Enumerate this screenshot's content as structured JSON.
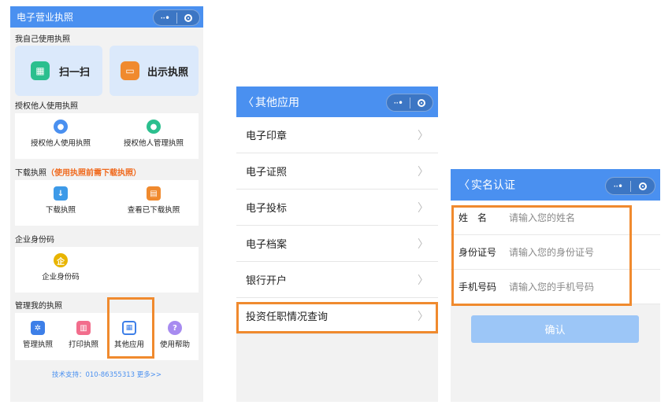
{
  "screen1": {
    "nav_title": "电子营业执照",
    "menu_dots": "··•",
    "section_own": "我自己使用执照",
    "scan_label": "扫一扫",
    "show_license_label": "出示执照",
    "section_authorize": "授权他人使用执照",
    "authorize_use_label": "授权他人使用执照",
    "authorize_manage_label": "授权他人管理执照",
    "section_download": "下载执照",
    "section_download_note": "（使用执照前需下载执照）",
    "download_label": "下载执照",
    "view_downloaded_label": "查看已下载执照",
    "section_enterprise_id": "企业身份码",
    "enterprise_id_label": "企业身份码",
    "enterprise_icon_char": "企",
    "section_manage": "管理我的执照",
    "manage_label": "管理执照",
    "print_label": "打印执照",
    "other_apps_label": "其他应用",
    "help_label": "使用帮助",
    "support_text": "技术支持：010-86355313 更多>>"
  },
  "screen2": {
    "back": "〈",
    "nav_title": "其他应用",
    "menu_dots": "··•",
    "items": [
      "电子印章",
      "电子证照",
      "电子投标",
      "电子档案",
      "银行开户",
      "投资任职情况查询"
    ],
    "chevron": "〉"
  },
  "screen3": {
    "back": "〈",
    "nav_title": "实名认证",
    "menu_dots": "··•",
    "name_label": "姓　名",
    "name_placeholder": "请输入您的姓名",
    "id_label": "身份证号",
    "id_placeholder": "请输入您的身份证号",
    "phone_label": "手机号码",
    "phone_placeholder": "请输入您的手机号码",
    "confirm_label": "确认"
  },
  "colors": {
    "nav_blue": "#4a90f0",
    "highlight_orange": "#f08a2e",
    "download_note_orange": "#f06a1e",
    "confirm_button": "#9cc6f7"
  }
}
